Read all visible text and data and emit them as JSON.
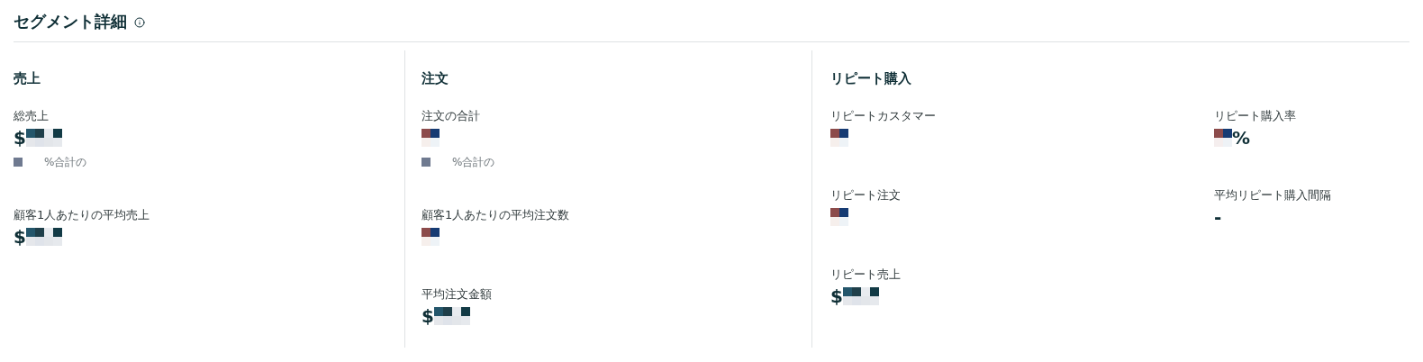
{
  "title": "セグメント詳細",
  "sections": [
    {
      "title": "売上",
      "columns": [
        [
          {
            "label": "総売上",
            "kind": "currency",
            "prefix": "$",
            "note": "%合計の"
          },
          {
            "label": "顧客1人あたりの平均売上",
            "kind": "currency",
            "prefix": "$"
          }
        ]
      ]
    },
    {
      "title": "注文",
      "columns": [
        [
          {
            "label": "注文の合計",
            "kind": "count",
            "note": "%合計の"
          },
          {
            "label": "顧客1人あたりの平均注文数",
            "kind": "count"
          },
          {
            "label": "平均注文金額",
            "kind": "currency",
            "prefix": "$"
          }
        ]
      ]
    },
    {
      "title": "リピート購入",
      "columns": [
        [
          {
            "label": "リピートカスタマー",
            "kind": "count"
          },
          {
            "label": "リピート注文",
            "kind": "count"
          },
          {
            "label": "リピート売上",
            "kind": "currency",
            "prefix": "$"
          }
        ],
        [
          {
            "label": "リピート購入率",
            "kind": "percent",
            "suffix": "%"
          },
          {
            "label": "平均リピート購入間隔",
            "kind": "text",
            "value": "-"
          }
        ]
      ]
    }
  ]
}
